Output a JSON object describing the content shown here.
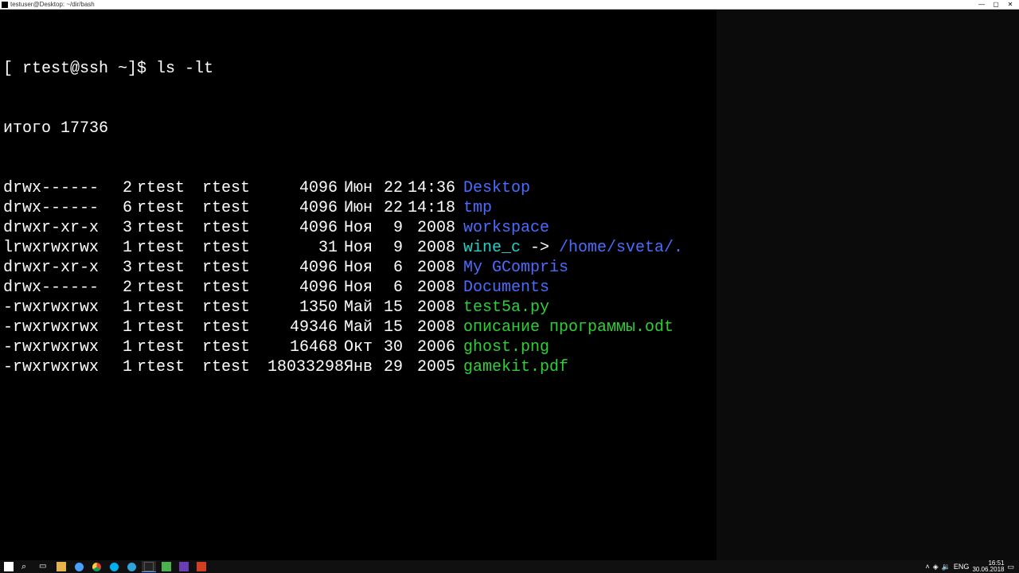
{
  "window": {
    "title": "testuser@Desktop: ~/dir/bash",
    "btn_min": "—",
    "btn_max": "▢",
    "btn_close": "✕"
  },
  "terminal": {
    "prompt": "[ rtest@ssh ~]$ ",
    "command": "ls -lt",
    "total_line": "итого 17736",
    "arrow": " -> ",
    "rows": [
      {
        "perm": "drwx------",
        "links": "2",
        "owner": "rtest",
        "group": "rtest",
        "size": "4096",
        "month": "Июн",
        "day": "22",
        "time": "14:36",
        "name": "Desktop",
        "cls": "c-dir"
      },
      {
        "perm": "drwx------",
        "links": "6",
        "owner": "rtest",
        "group": "rtest",
        "size": "4096",
        "month": "Июн",
        "day": "22",
        "time": "14:18",
        "name": "tmp",
        "cls": "c-dir"
      },
      {
        "perm": "drwxr-xr-x",
        "links": "3",
        "owner": "rtest",
        "group": "rtest",
        "size": "4096",
        "month": "Ноя",
        "day": "9",
        "time": "2008",
        "name": "workspace",
        "cls": "c-dir"
      },
      {
        "perm": "lrwxrwxrwx",
        "links": "1",
        "owner": "rtest",
        "group": "rtest",
        "size": "31",
        "month": "Ноя",
        "day": "9",
        "time": "2008",
        "name": "wine_c",
        "cls": "c-link",
        "target": "/home/sveta/."
      },
      {
        "perm": "drwxr-xr-x",
        "links": "3",
        "owner": "rtest",
        "group": "rtest",
        "size": "4096",
        "month": "Ноя",
        "day": "6",
        "time": "2008",
        "name": "My GCompris",
        "cls": "c-dir"
      },
      {
        "perm": "drwx------",
        "links": "2",
        "owner": "rtest",
        "group": "rtest",
        "size": "4096",
        "month": "Ноя",
        "day": "6",
        "time": "2008",
        "name": "Documents",
        "cls": "c-dir"
      },
      {
        "perm": "-rwxrwxrwx",
        "links": "1",
        "owner": "rtest",
        "group": "rtest",
        "size": "1350",
        "month": "Май",
        "day": "15",
        "time": "2008",
        "name": "test5a.py",
        "cls": "c-exe"
      },
      {
        "perm": "-rwxrwxrwx",
        "links": "1",
        "owner": "rtest",
        "group": "rtest",
        "size": "49346",
        "month": "Май",
        "day": "15",
        "time": "2008",
        "name": "описание программы.odt",
        "cls": "c-exe"
      },
      {
        "perm": "-rwxrwxrwx",
        "links": "1",
        "owner": "rtest",
        "group": "rtest",
        "size": "16468",
        "month": "Окт",
        "day": "30",
        "time": "2006",
        "name": "ghost.png",
        "cls": "c-exe"
      },
      {
        "perm": "-rwxrwxrwx",
        "links": "1",
        "owner": "rtest",
        "group": "rtest",
        "size": "18033298",
        "month": "Янв",
        "day": "29",
        "time": "2005",
        "name": "gamekit.pdf",
        "cls": "c-exe"
      }
    ]
  },
  "taskbar": {
    "tray_lang": "ENG",
    "clock_time": "16:51",
    "clock_date": "30.06.2018",
    "items": [
      {
        "name": "start-button",
        "icon": "ico-win"
      },
      {
        "name": "search-button",
        "icon": "ico-search"
      },
      {
        "name": "task-view-button",
        "icon": "ico-task"
      },
      {
        "name": "file-explorer",
        "icon": "ico-folder"
      },
      {
        "name": "edge-browser",
        "icon": "ico-edge"
      },
      {
        "name": "chrome-browser",
        "icon": "ico-chrome"
      },
      {
        "name": "skype",
        "icon": "ico-skype"
      },
      {
        "name": "telegram",
        "icon": "ico-telegram"
      },
      {
        "name": "terminal",
        "icon": "ico-terminal",
        "active": true
      },
      {
        "name": "app-green",
        "icon": "ico-green"
      },
      {
        "name": "app-purple",
        "icon": "ico-purple"
      },
      {
        "name": "app-red",
        "icon": "ico-red"
      }
    ]
  }
}
